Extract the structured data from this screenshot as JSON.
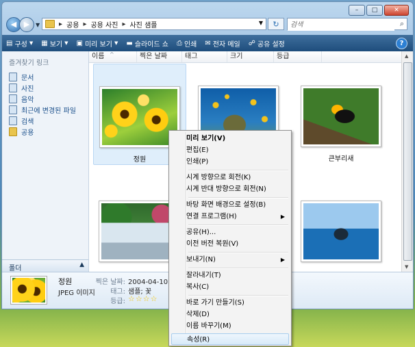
{
  "address": {
    "crumbs": [
      "공용",
      "공용 사진",
      "사진 샘플"
    ]
  },
  "search": {
    "placeholder": "검색"
  },
  "toolbar": {
    "organize": "구성",
    "views": "보기",
    "preview": "미리 보기",
    "slideshow": "슬라이드 쇼",
    "print": "인쇄",
    "email": "전자 메일",
    "share": "공유 설정",
    "help": "?"
  },
  "left_pane": {
    "title": "즐겨찾기 링크",
    "links": [
      "문서",
      "사진",
      "음악",
      "최근에 변경된 파일",
      "검색",
      "공용"
    ],
    "folders_label": "폴더"
  },
  "columns": [
    "이름",
    "찍은 날짜",
    "태그",
    "크기",
    "등급"
  ],
  "items": [
    {
      "caption": "정원"
    },
    {
      "caption": ""
    },
    {
      "caption": "큰부리새"
    },
    {
      "caption": ""
    },
    {
      "caption": ""
    }
  ],
  "details": {
    "name": "정원",
    "type": "JPEG 이미지",
    "date_label": "찍은 날짜:",
    "date_value": "2004-04-10 오",
    "tags_label": "태그:",
    "tags_value": "샘플; 꽃",
    "rating_label": "등급:",
    "rating": 4
  },
  "context_menu": [
    "미리 보기(V)",
    "편집(E)",
    "인쇄(P)",
    "시계 방향으로 회전(K)",
    "시계 반대 방향으로 회전(N)",
    "바탕 화면 배경으로 설정(B)",
    "연결 프로그램(H)",
    "공유(H)...",
    "이전 버전 복원(V)",
    "보내기(N)",
    "잘라내기(T)",
    "복사(C)",
    "바로 가기 만들기(S)",
    "삭제(D)",
    "이름 바꾸기(M)",
    "속성(R)"
  ]
}
